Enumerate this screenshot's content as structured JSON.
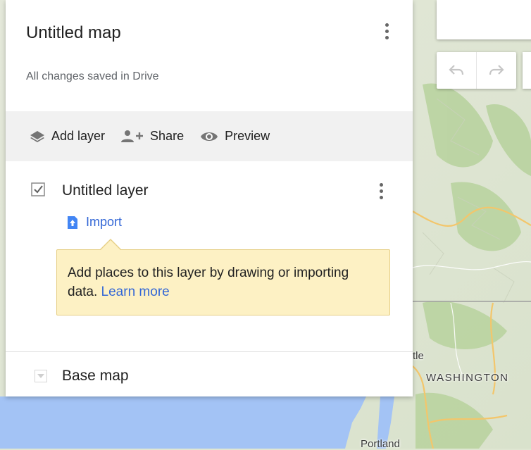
{
  "map": {
    "labels": {
      "state": "WASHINGTON",
      "city_top": "tle",
      "city_bottom": "Portland"
    }
  },
  "panel": {
    "title": "Untitled map",
    "save_status": "All changes saved in Drive",
    "toolbar": {
      "add_layer": "Add layer",
      "share": "Share",
      "preview": "Preview"
    },
    "layer": {
      "name": "Untitled layer",
      "checked": true,
      "import_label": "Import",
      "tooltip_text": "Add places to this layer by drawing or importing data.",
      "tooltip_link": "Learn more"
    },
    "base_map": {
      "label": "Base map"
    }
  },
  "icons": {
    "add_layer": "layers-icon",
    "share": "add-person-icon",
    "preview": "eye-icon",
    "import": "file-upload-icon",
    "undo": "undo-icon",
    "redo": "redo-icon",
    "menu": "more-vert-icon"
  },
  "colors": {
    "link": "#3367d6",
    "tooltip_bg": "#fdf1c4",
    "toolbar_bg": "#f1f1f1"
  }
}
